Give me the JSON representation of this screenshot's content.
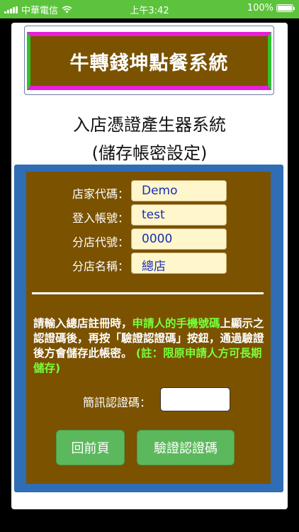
{
  "status_bar": {
    "carrier": "中華電信",
    "time": "上午3:42",
    "battery_percent": "100%",
    "battery_level": 1.0
  },
  "banner": {
    "title": "牛轉錢坤點餐系統"
  },
  "subtitle": {
    "line1": "入店憑證產生器系統",
    "line2": "(儲存帳密設定)"
  },
  "fields": [
    {
      "label": "店家代碼：",
      "value": "Demo"
    },
    {
      "label": "登入帳號：",
      "value": "test"
    },
    {
      "label": "分店代號：",
      "value": "0000"
    },
    {
      "label": "分店名稱：",
      "value": "總店"
    }
  ],
  "notice": {
    "part1": "請輸入總店註冊時，",
    "part2": "申請人的手機號碼",
    "part3": "上顯示之認證碼後，再按「驗證認證碼」按鈕，通過驗證後方會儲存此帳密。",
    "part4": "(註：限原申請人方可長期儲存)"
  },
  "sms": {
    "label": "簡訊認證碼：",
    "value": "",
    "placeholder": ""
  },
  "buttons": {
    "back": "回前頁",
    "verify": "驗證認證碼"
  },
  "colors": {
    "status_bar": "#5cc43c",
    "banner_bg": "#7a5200",
    "banner_stripe": "#e61fd8",
    "banner_side": "#2ec22e",
    "panel_border": "#2f6db5",
    "field_bg": "#fff6cc",
    "highlight_text": "#78ff3c",
    "button": "#5cb85c"
  }
}
